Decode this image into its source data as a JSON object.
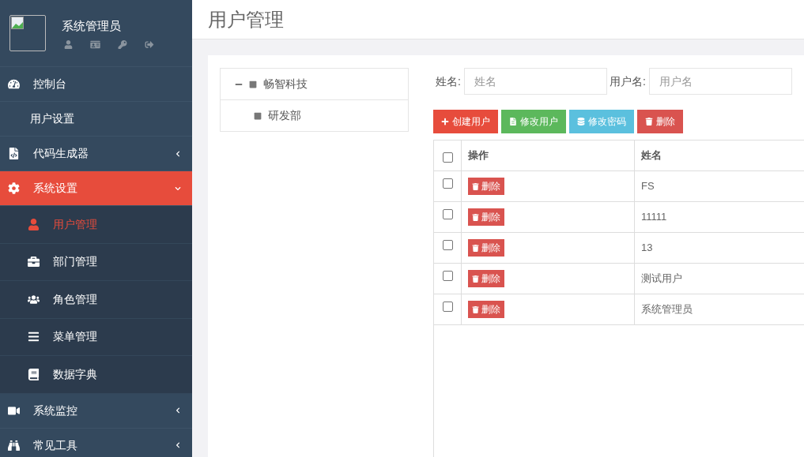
{
  "profile": {
    "name": "系统管理员"
  },
  "sidebar": {
    "items": [
      {
        "label": "控制台",
        "kind": "link",
        "selected": false
      },
      {
        "label": "用户设置",
        "kind": "plain",
        "selected": false
      },
      {
        "label": "代码生成器",
        "kind": "menu",
        "expanded": false,
        "selected": false
      },
      {
        "label": "系统设置",
        "kind": "menu",
        "expanded": true,
        "selected": true,
        "children": [
          {
            "label": "用户管理",
            "selected": true
          },
          {
            "label": "部门管理",
            "selected": false
          },
          {
            "label": "角色管理",
            "selected": false
          },
          {
            "label": "菜单管理",
            "selected": false
          },
          {
            "label": "数据字典",
            "selected": false
          }
        ]
      },
      {
        "label": "系统监控",
        "kind": "menu",
        "expanded": false,
        "selected": false
      },
      {
        "label": "常见工具",
        "kind": "menu",
        "expanded": false,
        "selected": false
      }
    ]
  },
  "page": {
    "title": "用户管理"
  },
  "tree": [
    {
      "label": "畅智科技",
      "expanded": true,
      "children": [
        {
          "label": "研发部"
        }
      ]
    }
  ],
  "search": [
    {
      "label": "姓名:",
      "placeholder": "姓名"
    },
    {
      "label": "用户名:",
      "placeholder": "用户名"
    }
  ],
  "toolbar": [
    {
      "kind": "create",
      "label": "创建用户"
    },
    {
      "kind": "edit",
      "label": "修改用户"
    },
    {
      "kind": "password",
      "label": "修改密码"
    },
    {
      "kind": "delete",
      "label": "删除"
    }
  ],
  "table": {
    "select_all": {
      "checked": false
    },
    "columns": [
      "操作",
      "姓名"
    ],
    "rows": [
      {
        "checked": false,
        "action": "删除",
        "name": "FS"
      },
      {
        "checked": false,
        "action": "删除",
        "name": "11111"
      },
      {
        "checked": false,
        "action": "删除",
        "name": "13"
      },
      {
        "checked": false,
        "action": "删除",
        "name": "测试用户"
      },
      {
        "checked": false,
        "action": "删除",
        "name": "系统管理员"
      }
    ]
  }
}
